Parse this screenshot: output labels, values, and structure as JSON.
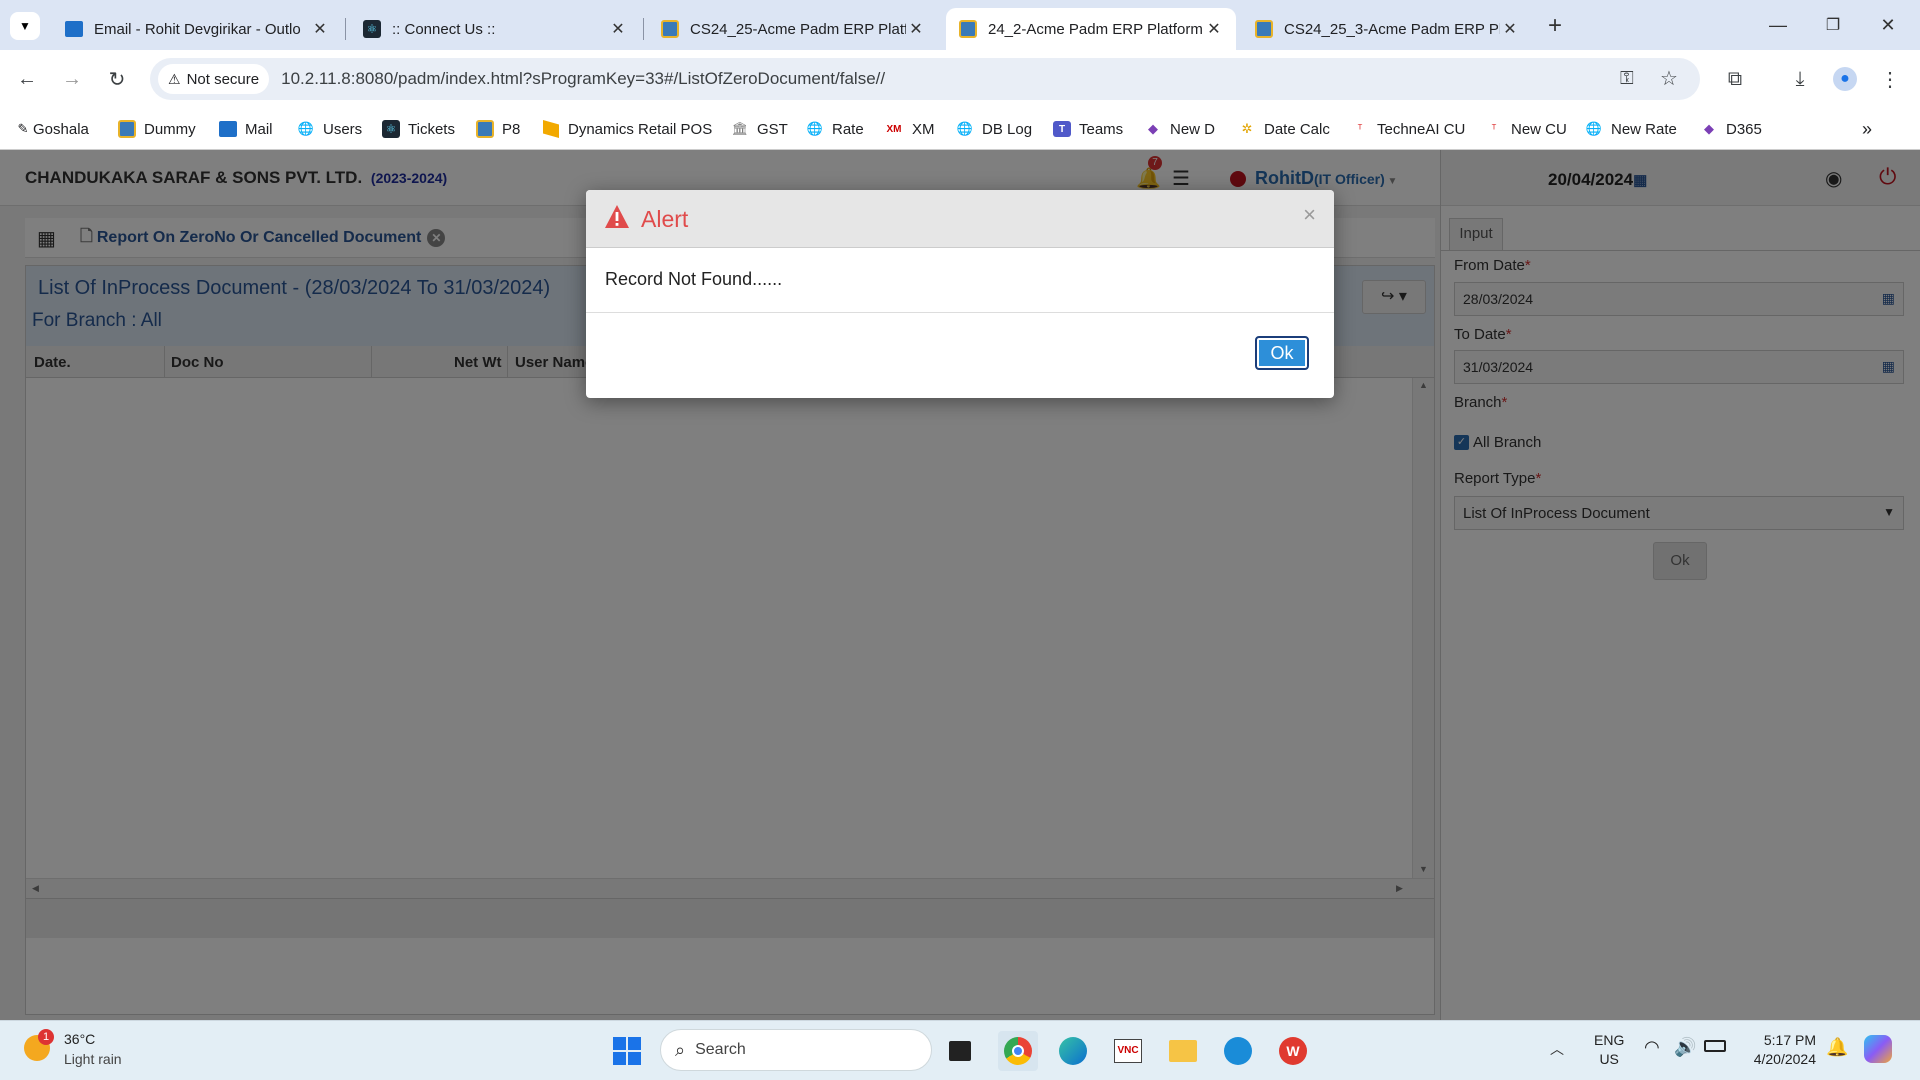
{
  "browser": {
    "tabs": [
      {
        "title": "Email - Rohit Devgirikar - Outlo",
        "active": false
      },
      {
        "title": ":: Connect Us ::",
        "active": false
      },
      {
        "title": "CS24_25-Acme Padm ERP Platf",
        "active": false
      },
      {
        "title": "24_2-Acme Padm ERP Platform",
        "active": true
      },
      {
        "title": "CS24_25_3-Acme Padm ERP Pl",
        "active": false
      }
    ],
    "not_secure": "Not secure",
    "url": "10.2.11.8:8080/padm/index.html?sProgramKey=33#/ListOfZeroDocument/false//",
    "bookmarks": [
      "Goshala",
      "Dummy",
      "Mail",
      "Users",
      "Tickets",
      "P8",
      "Dynamics Retail POS",
      "GST",
      "Rate",
      "XM",
      "DB Log",
      "Teams",
      "New D",
      "Date Calc",
      "TechneAI CU",
      "New CU",
      "New Rate",
      "D365"
    ]
  },
  "app": {
    "company": "CHANDUKAKA SARAF & SONS PVT. LTD.",
    "year": "(2023-2024)",
    "notification_count": "7",
    "user": "RohitD",
    "role": "(IT Officer)",
    "date": "20/04/2024",
    "menu_tab": "Report On ZeroNo Or Cancelled Document",
    "report_title": "List Of InProcess Document - (28/03/2024 To 31/03/2024)",
    "branch_line": "For Branch : All",
    "columns": [
      "Date.",
      "Doc No",
      "Net Wt",
      "User Name"
    ]
  },
  "panel": {
    "tab": "Input",
    "from_date_label": "From Date",
    "from_date": "28/03/2024",
    "to_date_label": "To Date",
    "to_date": "31/03/2024",
    "branch_label": "Branch",
    "all_branch": "All Branch",
    "report_type_label": "Report Type",
    "report_type": "List Of InProcess Document",
    "ok": "Ok"
  },
  "modal": {
    "title": "Alert",
    "message": "Record Not Found......",
    "ok": "Ok"
  },
  "taskbar": {
    "weather_temp": "36°C",
    "weather_desc": "Light rain",
    "weather_badge": "1",
    "search": "Search",
    "lang1": "ENG",
    "lang2": "US",
    "time": "5:17 PM",
    "date": "4/20/2024"
  }
}
